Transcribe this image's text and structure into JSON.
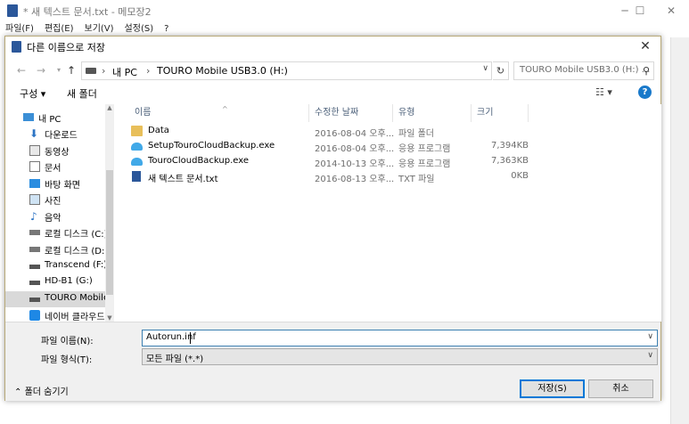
{
  "notepad": {
    "title": "* 새 텍스트 문서.txt - 메모장2",
    "menu": [
      "파일(F)",
      "편집(E)",
      "보기(V)",
      "설정(S)",
      "?"
    ]
  },
  "dialog": {
    "title": "다른 이름으로 저장",
    "close": "✕",
    "address": {
      "segments": [
        "내 PC",
        "TOURO Mobile USB3.0  (H:)"
      ],
      "separator": "›"
    },
    "search_placeholder": "TOURO Mobile USB3.0  (H:) ...",
    "toolbar": {
      "organize": "구성 ▾",
      "new_folder": "새 폴더",
      "help": "?"
    },
    "nav_items": [
      {
        "label": "내 PC",
        "icon": "pc-icon",
        "indent": 0
      },
      {
        "label": "다운로드",
        "icon": "download-icon",
        "indent": 1
      },
      {
        "label": "동영상",
        "icon": "video-icon",
        "indent": 1
      },
      {
        "label": "문서",
        "icon": "document-icon",
        "indent": 1
      },
      {
        "label": "바탕 화면",
        "icon": "desktop-icon",
        "indent": 1
      },
      {
        "label": "사진",
        "icon": "picture-icon",
        "indent": 1
      },
      {
        "label": "음악",
        "icon": "music-icon",
        "indent": 1
      },
      {
        "label": "로컬 디스크 (C:)",
        "icon": "drive-icon",
        "indent": 1
      },
      {
        "label": "로컬 디스크 (D:)",
        "icon": "drive-icon",
        "indent": 1
      },
      {
        "label": "Transcend (F:)",
        "icon": "usb-drive-icon",
        "indent": 1
      },
      {
        "label": "HD-B1 (G:)",
        "icon": "usb-drive-icon",
        "indent": 1
      },
      {
        "label": "TOURO Mobile U",
        "icon": "usb-drive-icon",
        "indent": 1,
        "selected": true
      },
      {
        "label": "네이버 클라우드",
        "icon": "cloud-icon",
        "indent": 0
      }
    ],
    "columns": [
      "이름",
      "수정한 날짜",
      "유형",
      "크기"
    ],
    "files": [
      {
        "name": "Data",
        "date": "2016-08-04 오후...",
        "type": "파일 폴더",
        "size": "",
        "icon": "folder-icon"
      },
      {
        "name": "SetupTouroCloudBackup.exe",
        "date": "2016-08-04 오후...",
        "type": "응용 프로그램",
        "size": "7,394KB",
        "icon": "cloud-app-icon"
      },
      {
        "name": "TouroCloudBackup.exe",
        "date": "2014-10-13 오후...",
        "type": "응용 프로그램",
        "size": "7,363KB",
        "icon": "cloud-app-icon"
      },
      {
        "name": "새 텍스트 문서.txt",
        "date": "2016-08-13 오후...",
        "type": "TXT 파일",
        "size": "0KB",
        "icon": "text-file-icon"
      }
    ],
    "filename_label": "파일 이름(N):",
    "filename_value": "Autorun.inf",
    "filetype_label": "파일 형식(T):",
    "filetype_value": "모든 파일 (*.*)",
    "hide_folders": "폴더 숨기기",
    "save_button": "저장(S)",
    "cancel_button": "취소"
  },
  "colors": {
    "dialog_border": "#b7a877",
    "accent": "#0078d7",
    "help": "#1979ca",
    "folder": "#e8bf5a"
  }
}
